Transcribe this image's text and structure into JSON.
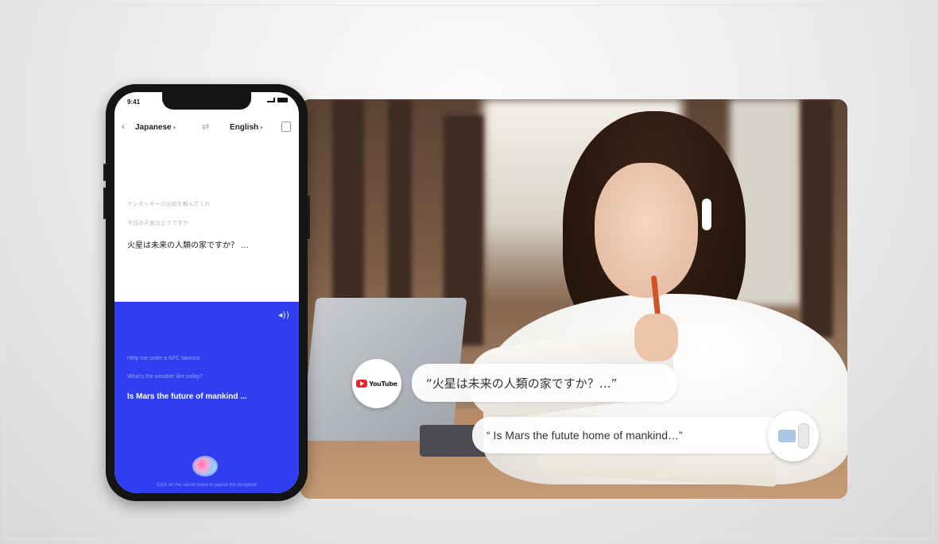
{
  "phone": {
    "status_time": "9:41",
    "source_lang": "Japanese",
    "target_lang": "English",
    "source_lines": [
      "ケンタッキーの出前を頼んでくれ",
      "今日の天気はどうですか",
      "火星は未来の人類の家ですか？ ..."
    ],
    "target_lines": [
      "Help me order a KFC takeout",
      "What's the weather like today?",
      "Is Mars the future of mankind ..."
    ],
    "hint": "Click on the sound wave to pause the reception"
  },
  "scene": {
    "source_badge": "YouTube",
    "caption_jp": "“火星は未来の人類の家ですか？…”",
    "caption_en": "“ Is Mars the futute home  of mankind…”"
  },
  "icons": {
    "back": "chevron-left-icon",
    "swap": "swap-icon",
    "speaker": "speaker-icon",
    "mic": "sound-wave-icon",
    "earbuds": "earbuds-icon"
  },
  "colors": {
    "accent_blue": "#2e3ef0",
    "youtube_red": "#e22222"
  }
}
